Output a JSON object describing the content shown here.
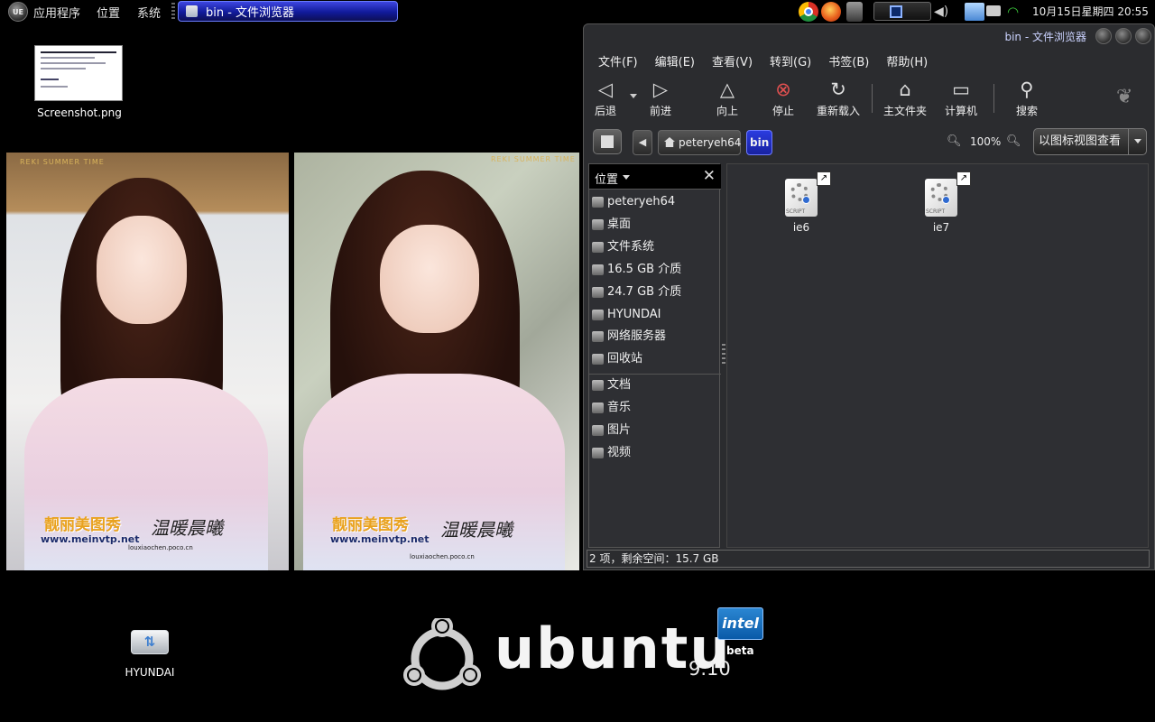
{
  "top_panel": {
    "logo_text": "UE",
    "menus": [
      "应用程序",
      "位置",
      "系统"
    ],
    "task_button": "bin - 文件浏览器",
    "tray_icons": [
      "chrome-icon",
      "firefox-icon",
      "trash-icon",
      "workspace-switcher",
      "volume-icon",
      "notification-icon",
      "keyboard-icon",
      "wifi-icon"
    ],
    "clock": "10月15日星期四  20:55"
  },
  "desktop": {
    "screenshot_label": "Screenshot.png",
    "drive_label": "HYUNDAI",
    "photo_caption": "REKI SUMMER TIME",
    "photo_watermark_cn": "靓丽美图秀",
    "photo_watermark_url": "www.meinvtp.net",
    "photo_watermark_script": "温暖晨曦",
    "photo_watermark_small": "louxiaochen.poco.cn",
    "ubuntu_text": "ubuntu",
    "ubuntu_version": "9.10",
    "intel_text": "intel",
    "intel_beta": "beta"
  },
  "window": {
    "title": "bin - 文件浏览器",
    "menubar": [
      "文件(F)",
      "编辑(E)",
      "查看(V)",
      "转到(G)",
      "书签(B)",
      "帮助(H)"
    ],
    "toolbar": {
      "back": "后退",
      "forward": "前进",
      "up": "向上",
      "stop": "停止",
      "reload": "重新载入",
      "home": "主文件夹",
      "computer": "计算机",
      "search": "搜索"
    },
    "breadcrumbs": [
      "peteryeh64",
      "bin"
    ],
    "zoom": "100%",
    "view_mode": "以图标视图查看",
    "sidebar": {
      "header": "位置",
      "places": [
        "peteryeh64",
        "桌面",
        "文件系统",
        "16.5 GB 介质",
        "24.7 GB 介质",
        "HYUNDAI",
        "网络服务器",
        "回收站"
      ],
      "bookmarks": [
        "文档",
        "音乐",
        "图片",
        "视频"
      ]
    },
    "files": [
      {
        "name": "ie6",
        "icon": "script-icon"
      },
      {
        "name": "ie7",
        "icon": "script-icon"
      }
    ],
    "status": "2 项，剩余空间：15.7 GB"
  }
}
